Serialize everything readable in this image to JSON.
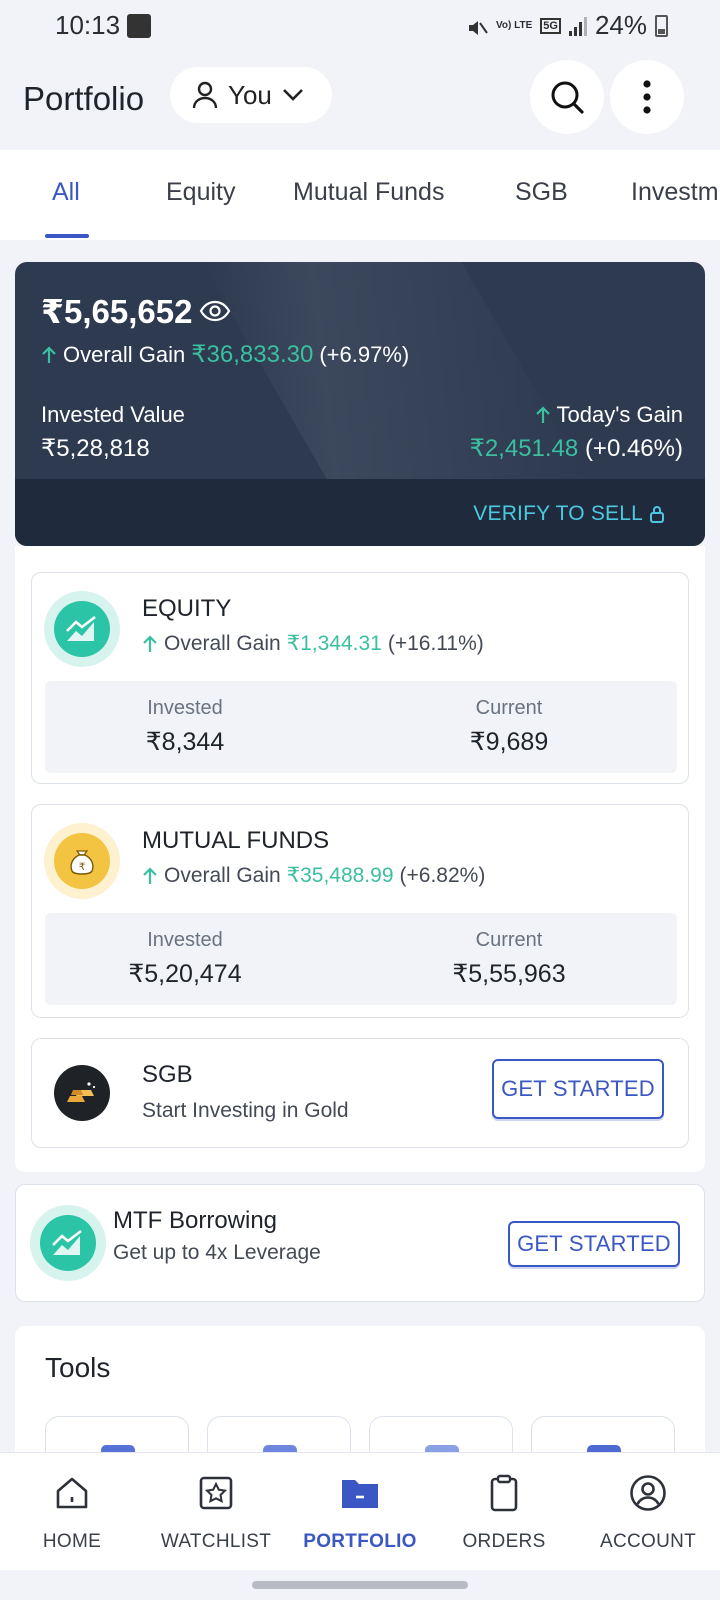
{
  "status_bar": {
    "time": "10:13",
    "battery": "24%",
    "network": "5G",
    "volte": "Vo) LTE"
  },
  "header": {
    "title": "Portfolio",
    "profile_label": "You"
  },
  "tabs": [
    "All",
    "Equity",
    "Mutual Funds",
    "SGB",
    "Investm"
  ],
  "active_tab": "All",
  "summary": {
    "total_value": "₹5,65,652",
    "overall_gain_label": "Overall Gain",
    "overall_gain_value": "₹36,833.30",
    "overall_gain_pct": "(+6.97%)",
    "invested_label": "Invested Value",
    "invested_value": "₹5,28,818",
    "today_gain_label": "Today's Gain",
    "today_gain_value": "₹2,451.48",
    "today_gain_pct": "(+0.46%)",
    "verify_label": "VERIFY TO SELL"
  },
  "holdings": [
    {
      "name": "EQUITY",
      "gain_label": "Overall Gain",
      "gain_value": "₹1,344.31",
      "gain_pct": "(+16.11%)",
      "invested_label": "Invested",
      "invested_value": "₹8,344",
      "current_label": "Current",
      "current_value": "₹9,689"
    },
    {
      "name": "MUTUAL FUNDS",
      "gain_label": "Overall Gain",
      "gain_value": "₹35,488.99",
      "gain_pct": "(+6.82%)",
      "invested_label": "Invested",
      "invested_value": "₹5,20,474",
      "current_label": "Current",
      "current_value": "₹5,55,963"
    }
  ],
  "sgb": {
    "name": "SGB",
    "subtitle": "Start Investing in Gold",
    "cta": "GET STARTED"
  },
  "mtf": {
    "title": "MTF Borrowing",
    "subtitle": "Get up to 4x Leverage",
    "cta": "GET STARTED"
  },
  "tools": {
    "title": "Tools"
  },
  "bottom_nav": [
    {
      "label": "HOME",
      "icon": "home-icon"
    },
    {
      "label": "WATCHLIST",
      "icon": "watchlist-icon"
    },
    {
      "label": "PORTFOLIO",
      "icon": "portfolio-icon"
    },
    {
      "label": "ORDERS",
      "icon": "orders-icon"
    },
    {
      "label": "ACCOUNT",
      "icon": "account-icon"
    }
  ],
  "colors": {
    "accent": "#3b57c4",
    "gain_green": "#3bbfa1",
    "card_dark": "#2d3a50",
    "verify_cyan": "#4cc9e0",
    "equity_icon": "#2bc4a6",
    "mf_icon": "#f3c342"
  }
}
